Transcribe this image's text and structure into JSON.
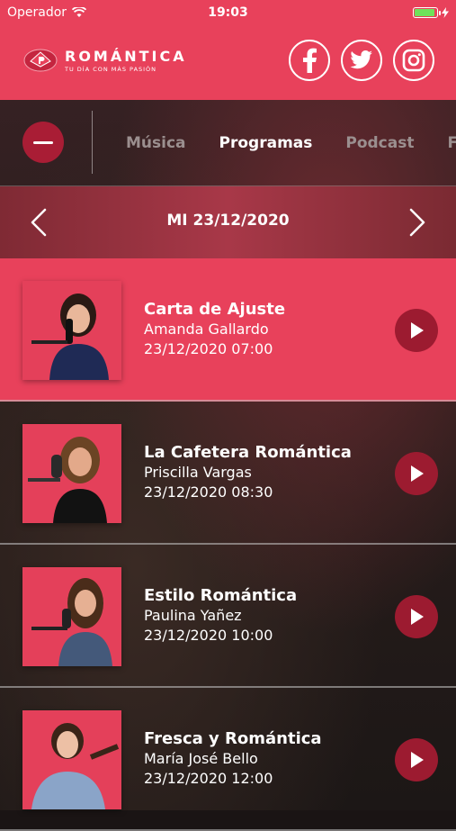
{
  "status": {
    "carrier": "Operador",
    "time": "19:03"
  },
  "header": {
    "logo_title": "ROMÁNTICA",
    "logo_subtitle": "TU DÍA CON MÁS PASIÓN",
    "social": [
      "facebook-icon",
      "twitter-icon",
      "instagram-icon"
    ]
  },
  "nav": {
    "tabs": [
      {
        "label": "Música",
        "active": false
      },
      {
        "label": "Programas",
        "active": true
      },
      {
        "label": "Podcast",
        "active": false
      },
      {
        "label": "Fa",
        "active": false
      }
    ]
  },
  "datebar": {
    "date": "MI 23/12/2020"
  },
  "programs": [
    {
      "title": "Carta de Ajuste",
      "host": "Amanda Gallardo",
      "datetime": "23/12/2020 07:00",
      "highlighted": true
    },
    {
      "title": "La Cafetera Romántica",
      "host": "Priscilla Vargas",
      "datetime": "23/12/2020 08:30",
      "highlighted": false
    },
    {
      "title": "Estilo Romántica",
      "host": "Paulina Yañez",
      "datetime": "23/12/2020 10:00",
      "highlighted": false
    },
    {
      "title": "Fresca y Romántica",
      "host": "María José Bello",
      "datetime": "23/12/2020 12:00",
      "highlighted": false
    }
  ],
  "colors": {
    "brand": "#e8415b",
    "button": "#9c1b30",
    "battery": "#6fe25a"
  }
}
